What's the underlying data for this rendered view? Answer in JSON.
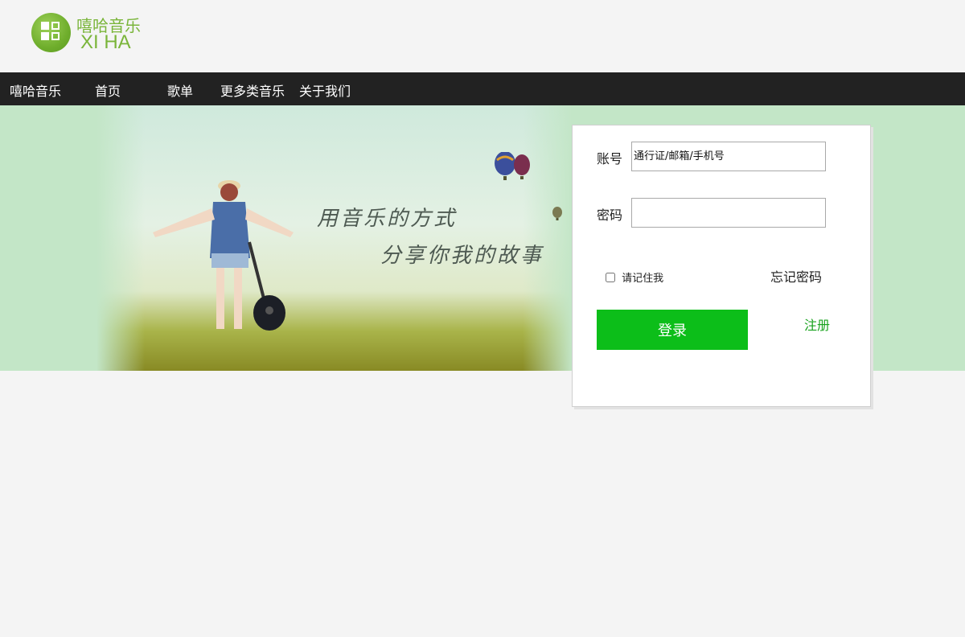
{
  "logo": {
    "name_cn": "嘻哈音乐",
    "name_en": "XI HA",
    "icon": "grid-logo-icon",
    "color": "#7ab53a"
  },
  "nav": {
    "brand": "嘻哈音乐",
    "items": [
      {
        "label": "首页"
      },
      {
        "label": "歌单"
      },
      {
        "label": "更多类音乐"
      },
      {
        "label": "关于我们"
      }
    ]
  },
  "banner": {
    "slogan_line1": "用音乐的方式",
    "slogan_line2": "分享你我的故事",
    "background": "#c3e6c7"
  },
  "login": {
    "account_label": "账号",
    "account_placeholder": "通行证/邮箱/手机号",
    "account_value": "",
    "password_label": "密码",
    "password_value": "",
    "remember_label": "请记住我",
    "remember_checked": false,
    "forgot_label": "忘记密码",
    "submit_label": "登录",
    "register_label": "注册",
    "submit_color": "#0cbe19",
    "register_color": "#17a21c"
  }
}
